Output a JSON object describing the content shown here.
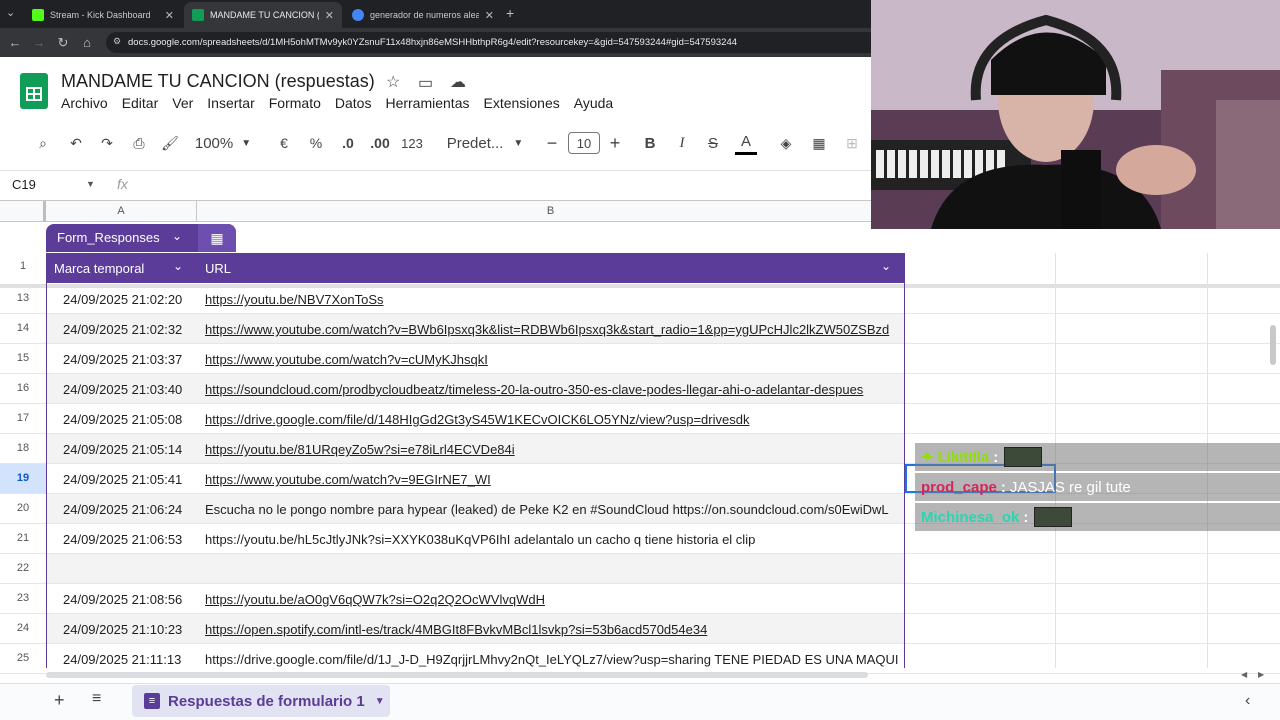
{
  "browser": {
    "tabs": [
      {
        "title": "Stream - Kick Dashboard",
        "active": false,
        "favicon_color": "#53fc18"
      },
      {
        "title": "MANDAME TU CANCION (resp",
        "active": true,
        "favicon_color": "#0f9d58"
      },
      {
        "title": "generador de numeros aleato",
        "active": false,
        "favicon_color": "#4285f4"
      }
    ],
    "url": "docs.google.com/spreadsheets/d/1MH5ohMTMv9yk0YZsnuF11x48hxjn86eMSHHbthpR6g4/edit?resourcekey=&gid=547593244#gid=547593244"
  },
  "sheets": {
    "title": "MANDAME TU CANCION (respuestas)",
    "menu": [
      "Archivo",
      "Editar",
      "Ver",
      "Insertar",
      "Formato",
      "Datos",
      "Herramientas",
      "Extensiones",
      "Ayuda"
    ],
    "toolbar": {
      "zoom": "100%",
      "currency": "€",
      "percent": "%",
      "dec_less": ".0",
      "dec_more": ".00",
      "number_format": "123",
      "font": "Predet...",
      "font_size": "10"
    },
    "name_box": "C19",
    "fx": "fx",
    "columns": [
      "A",
      "B"
    ],
    "table_name": "Form_Responses",
    "header": {
      "row": "1",
      "col_a": "Marca temporal",
      "col_b": "URL"
    },
    "rows": [
      {
        "num": "13",
        "a": "24/09/2025 21:02:20",
        "b": "https://youtu.be/NBV7XonToSs",
        "link": true
      },
      {
        "num": "14",
        "a": "24/09/2025 21:02:32",
        "b": "https://www.youtube.com/watch?v=BWb6Ipsxq3k&list=RDBWb6Ipsxq3k&start_radio=1&pp=ygUPcHJlc2lkZW50ZSBzd",
        "link": true
      },
      {
        "num": "15",
        "a": "24/09/2025 21:03:37",
        "b": "https://www.youtube.com/watch?v=cUMyKJhsqkI",
        "link": true
      },
      {
        "num": "16",
        "a": "24/09/2025 21:03:40",
        "b": "https://soundcloud.com/prodbycloudbeatz/timeless-20-la-outro-350-es-clave-podes-llegar-ahi-o-adelantar-despues",
        "link": true
      },
      {
        "num": "17",
        "a": "24/09/2025 21:05:08",
        "b": "https://drive.google.com/file/d/148HIgGd2Gt3yS45W1KECvOICK6LO5YNz/view?usp=drivesdk",
        "link": true
      },
      {
        "num": "18",
        "a": "24/09/2025 21:05:14",
        "b": "https://youtu.be/81URqeyZo5w?si=e78iLrl4ECVDe84i",
        "link": true
      },
      {
        "num": "19",
        "a": "24/09/2025 21:05:41",
        "b": "https://www.youtube.com/watch?v=9EGIrNE7_WI",
        "link": true
      },
      {
        "num": "20",
        "a": "24/09/2025 21:06:24",
        "b": "Escucha no le pongo nombre para hypear (leaked) de Peke K2 en #SoundCloud https://on.soundcloud.com/s0EwiDwL",
        "link": false
      },
      {
        "num": "21",
        "a": "24/09/2025 21:06:53",
        "b": "https://youtu.be/hL5cJtlyJNk?si=XXYK038uKqVP6IhI adelantalo un cacho q tiene historia el clip",
        "link": false
      },
      {
        "num": "22",
        "a": "",
        "b": "",
        "link": false
      },
      {
        "num": "23",
        "a": "24/09/2025 21:08:56",
        "b": "https://youtu.be/aO0gV6qQW7k?si=O2q2Q2OcWVlvqWdH",
        "link": true
      },
      {
        "num": "24",
        "a": "24/09/2025 21:10:23",
        "b": "https://open.spotify.com/intl-es/track/4MBGIt8FBvkvMBcl1lsvkp?si=53b6acd570d54e34",
        "link": true
      },
      {
        "num": "25",
        "a": "24/09/2025 21:11:13",
        "b": "https://drive.google.com/file/d/1J_J-D_H9ZqrjjrLMhvy2nQt_IeLYQLz7/view?usp=sharing TENE PIEDAD ES UNA MAQUI",
        "link": false
      }
    ],
    "sheet_tab": "Respuestas de formulario 1"
  },
  "chat": [
    {
      "user": "Likitilla",
      "message": "",
      "color": "#8ee000",
      "emote": true
    },
    {
      "user": "prod_cape",
      "message": "JASJAS re gil tute",
      "color": "#d6245c",
      "emote": false
    },
    {
      "user": "Michinesa_ok",
      "message": "",
      "color": "#2ad6b0",
      "emote": true
    }
  ],
  "colors": {
    "accent": "#5b3c99",
    "link": "#1f1f1f"
  }
}
